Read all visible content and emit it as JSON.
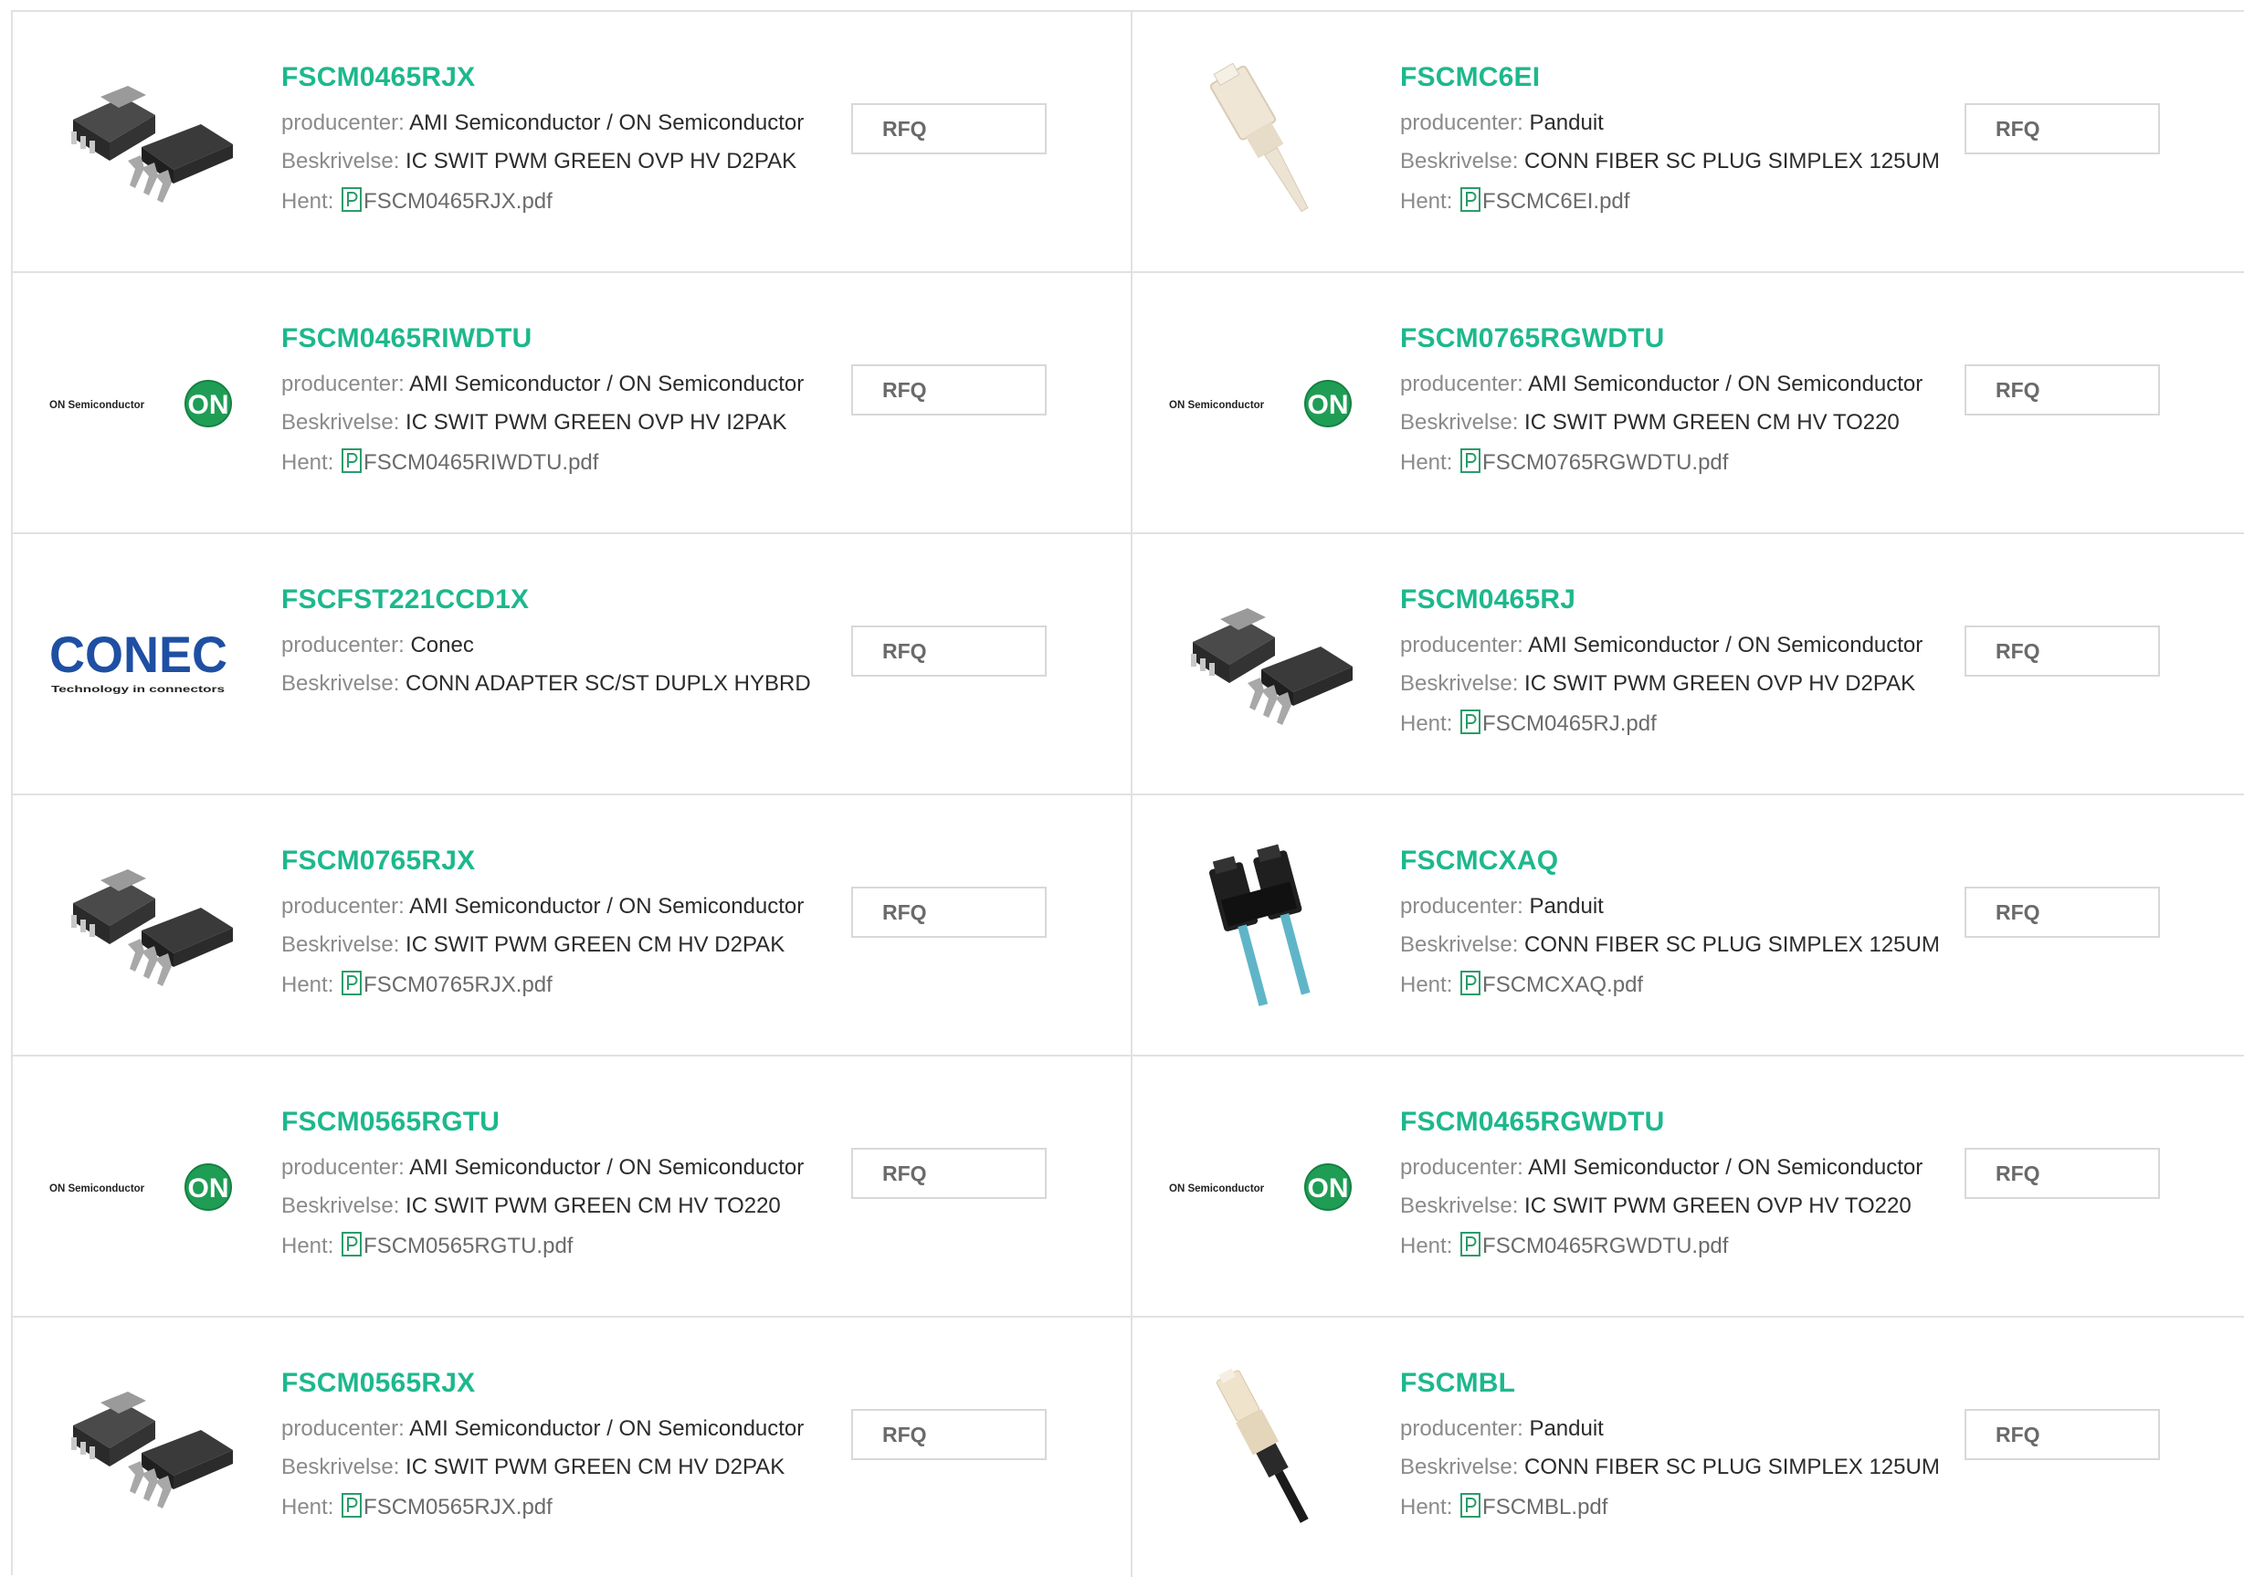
{
  "labels": {
    "manufacturer": "producenter:",
    "description": "Beskrivelse:",
    "download": "Hent:",
    "rfq": "RFQ"
  },
  "products": [
    {
      "part": "FSCM0465RJX",
      "manufacturer": "AMI Semiconductor / ON Semiconductor",
      "description": "IC SWIT PWM GREEN OVP HV D2PAK",
      "pdf": "FSCM0465RJX.pdf",
      "image": "d2pak-chip-icon"
    },
    {
      "part": "FSCMC6EI",
      "manufacturer": "Panduit",
      "description": "CONN FIBER SC PLUG SIMPLEX 125UM",
      "pdf": "FSCMC6EI.pdf",
      "image": "fiber-plug-icon"
    },
    {
      "part": "FSCM0465RIWDTU",
      "manufacturer": "AMI Semiconductor / ON Semiconductor",
      "description": "IC SWIT PWM GREEN OVP HV I2PAK",
      "pdf": "FSCM0465RIWDTU.pdf",
      "image": "on-semiconductor-logo"
    },
    {
      "part": "FSCM0765RGWDTU",
      "manufacturer": "AMI Semiconductor / ON Semiconductor",
      "description": "IC SWIT PWM GREEN CM HV TO220",
      "pdf": "FSCM0765RGWDTU.pdf",
      "image": "on-semiconductor-logo"
    },
    {
      "part": "FSCFST221CCD1X",
      "manufacturer": "Conec",
      "description": "CONN ADAPTER SC/ST DUPLX HYBRD",
      "pdf": null,
      "image": "conec-logo"
    },
    {
      "part": "FSCM0465RJ",
      "manufacturer": "AMI Semiconductor / ON Semiconductor",
      "description": "IC SWIT PWM GREEN OVP HV D2PAK",
      "pdf": "FSCM0465RJ.pdf",
      "image": "d2pak-chip-icon"
    },
    {
      "part": "FSCM0765RJX",
      "manufacturer": "AMI Semiconductor / ON Semiconductor",
      "description": "IC SWIT PWM GREEN CM HV D2PAK",
      "pdf": "FSCM0765RJX.pdf",
      "image": "d2pak-chip-icon"
    },
    {
      "part": "FSCMCXAQ",
      "manufacturer": "Panduit",
      "description": "CONN FIBER SC PLUG SIMPLEX 125UM",
      "pdf": "FSCMCXAQ.pdf",
      "image": "duplex-fiber-icon"
    },
    {
      "part": "FSCM0565RGTU",
      "manufacturer": "AMI Semiconductor / ON Semiconductor",
      "description": "IC SWIT PWM GREEN CM HV TO220",
      "pdf": "FSCM0565RGTU.pdf",
      "image": "on-semiconductor-logo"
    },
    {
      "part": "FSCM0465RGWDTU",
      "manufacturer": "AMI Semiconductor / ON Semiconductor",
      "description": "IC SWIT PWM GREEN OVP HV TO220",
      "pdf": "FSCM0465RGWDTU.pdf",
      "image": "on-semiconductor-logo"
    },
    {
      "part": "FSCM0565RJX",
      "manufacturer": "AMI Semiconductor / ON Semiconductor",
      "description": "IC SWIT PWM GREEN CM HV D2PAK",
      "pdf": "FSCM0565RJX.pdf",
      "image": "d2pak-chip-icon"
    },
    {
      "part": "FSCMBL",
      "manufacturer": "Panduit",
      "description": "CONN FIBER SC PLUG SIMPLEX 125UM",
      "pdf": "FSCMBL.pdf",
      "image": "fiber-plug-black-icon"
    }
  ],
  "logos": {
    "on_brand": "ON Semiconductor",
    "on_mark": "ON",
    "conec_brand": "CONEC",
    "conec_tagline": "Technology in connectors"
  },
  "colors": {
    "accent": "#1db88d",
    "on_green": "#1f9d55",
    "conec_blue": "#1e4fa3"
  }
}
